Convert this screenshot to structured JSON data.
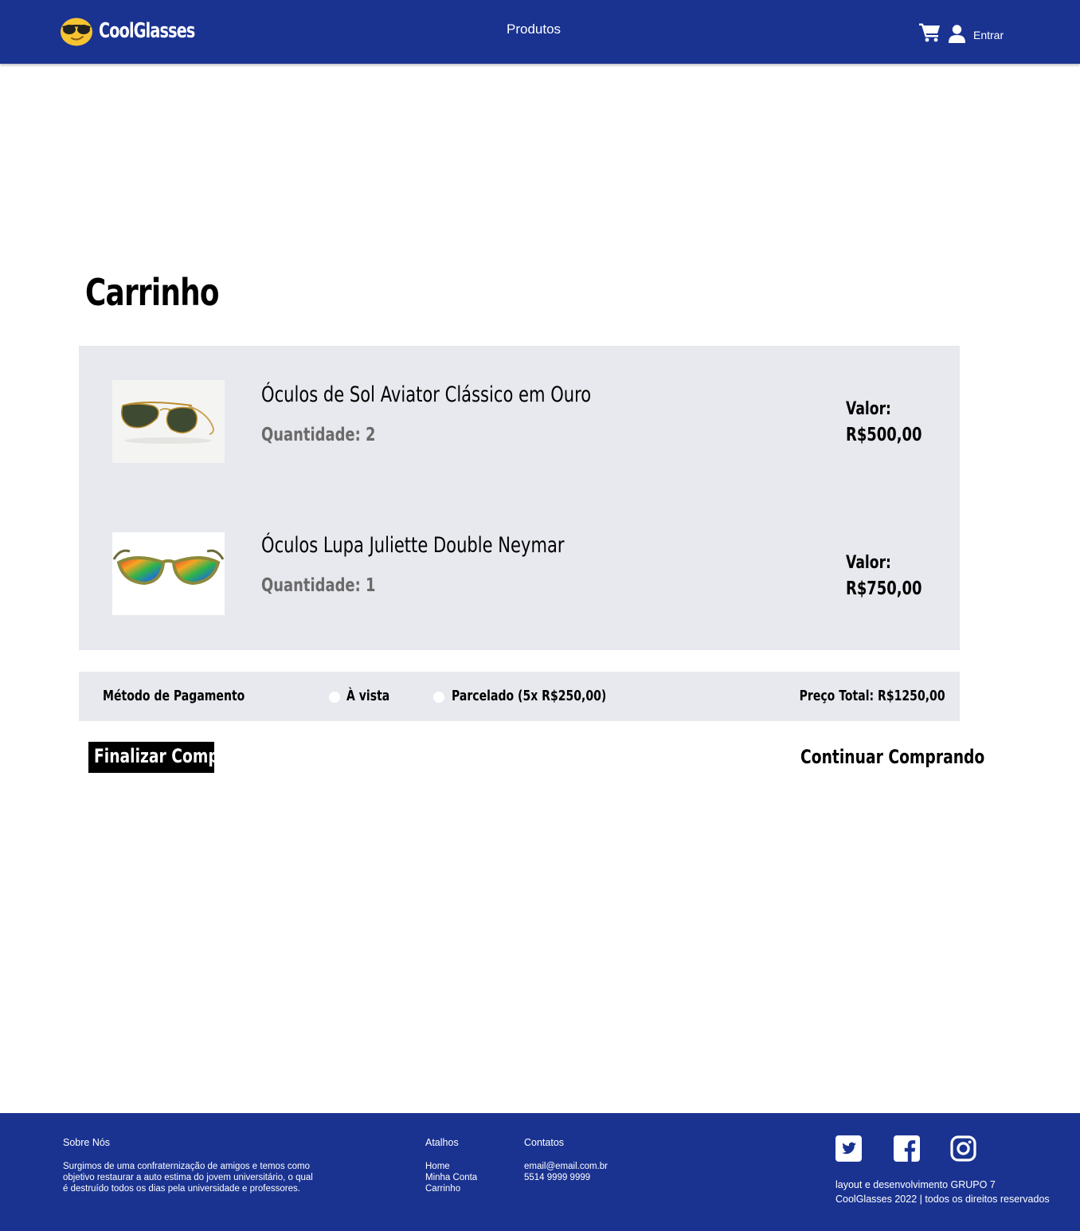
{
  "header": {
    "brand": "CoolGlasses",
    "nav": {
      "products": "Produtos"
    },
    "login": "Entrar"
  },
  "page": {
    "title": "Carrinho"
  },
  "cart": {
    "items": [
      {
        "name": "Óculos de Sol Aviator Clássico em Ouro",
        "quantity": "Quantidade: 2",
        "price_label": "Valor:",
        "price": "R$500,00"
      },
      {
        "name": "Óculos Lupa Juliette Double Neymar",
        "quantity": "Quantidade: 1",
        "price_label": "Valor:",
        "price": "R$750,00"
      }
    ]
  },
  "payment": {
    "label": "Método de Pagamento",
    "options": [
      "À vista",
      "Parcelado (5x R$250,00)"
    ],
    "total": "Preço Total: R$1250,00"
  },
  "actions": {
    "finish": "Finalizar Compra",
    "continue": "Continuar Comprando"
  },
  "footer": {
    "about": {
      "title": "Sobre Nós",
      "lines": [
        "Surgimos de uma confraternização de amigos e temos como",
        "objetivo restaurar a auto estima do jovem universitário, o qual",
        "é destruído todos os dias pela universidade e professores."
      ]
    },
    "shortcuts": {
      "title": "Atalhos",
      "links": [
        "Home",
        "Minha Conta",
        "Carrinho"
      ]
    },
    "contacts": {
      "title": "Contatos",
      "items": [
        "email@email.com.br",
        "5514 9999 9999"
      ]
    },
    "credits": [
      "layout e desenvolvimento GRUPO 7",
      "CoolGlasses 2022 | todos os direitos reservados"
    ]
  },
  "colors": {
    "primary": "#1a3391",
    "panel": "#e8e9ef",
    "button": "#000000"
  },
  "icons": [
    "sunglasses-emoji-icon",
    "cart-icon",
    "user-icon",
    "twitter-icon",
    "facebook-icon",
    "instagram-icon"
  ]
}
